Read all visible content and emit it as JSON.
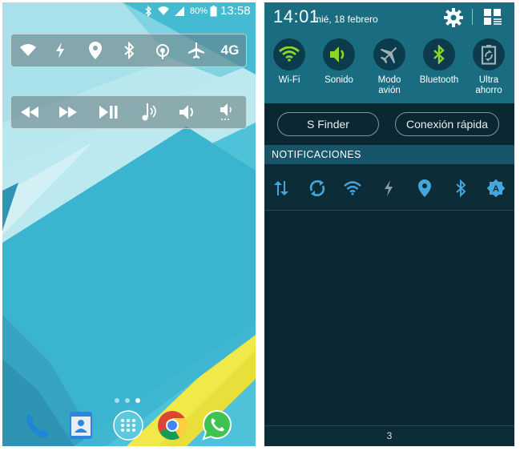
{
  "left_phone": {
    "status_bar": {
      "icons": [
        "bluetooth-icon",
        "wifi-icon",
        "signal-icon",
        "battery-icon"
      ],
      "battery_percent": "80%",
      "clock": "13:58"
    },
    "toggle_bar_1": [
      "wifi-icon",
      "flashlight-icon",
      "location-icon",
      "bluetooth-icon",
      "hotspot-icon",
      "airplane-icon",
      "4g-label"
    ],
    "toggle_bar_1_4g_label": "4G",
    "media_bar": [
      "rewind-icon",
      "fast-forward-icon",
      "play-pause-icon",
      "notification-sound-icon",
      "volume-icon",
      "volume-low-icon"
    ],
    "home_page_indicator": {
      "pages": 3,
      "current": 3
    },
    "dock": [
      "phone-app",
      "contacts-app",
      "app-drawer",
      "chrome-app",
      "whatsapp-app"
    ]
  },
  "right_phone": {
    "time": "14:01",
    "date": "mié, 18 febrero",
    "quick_toggles": [
      {
        "icon": "wifi-icon",
        "label": "Wi-Fi",
        "active": true
      },
      {
        "icon": "sound-icon",
        "label": "Sonido",
        "active": true
      },
      {
        "icon": "airplane-icon",
        "label": "Modo avión",
        "active": false
      },
      {
        "icon": "bluetooth-icon",
        "label": "Bluetooth",
        "active": true
      },
      {
        "icon": "power-saving-icon",
        "label": "Ultra ahorro",
        "active": false
      }
    ],
    "buttons": {
      "s_finder": "S Finder",
      "quick_connect": "Conexión rápida"
    },
    "notifications_header": "NOTIFICACIONES",
    "notification_icons": [
      "data-transfer-icon",
      "sync-icon",
      "wifi-icon",
      "flashlight-icon",
      "location-icon",
      "bluetooth-icon",
      "auto-brightness-icon"
    ],
    "auto_brightness_letter": "A",
    "notification_count": "3"
  },
  "colors": {
    "wallpaper_teal": "#4fc3d9",
    "panel_header": "#1a6d80",
    "panel_bg": "#0b2732",
    "active_green": "#8bd52c",
    "notif_icon_blue": "#44a6dc",
    "accent_yellow": "#f1e94a"
  }
}
